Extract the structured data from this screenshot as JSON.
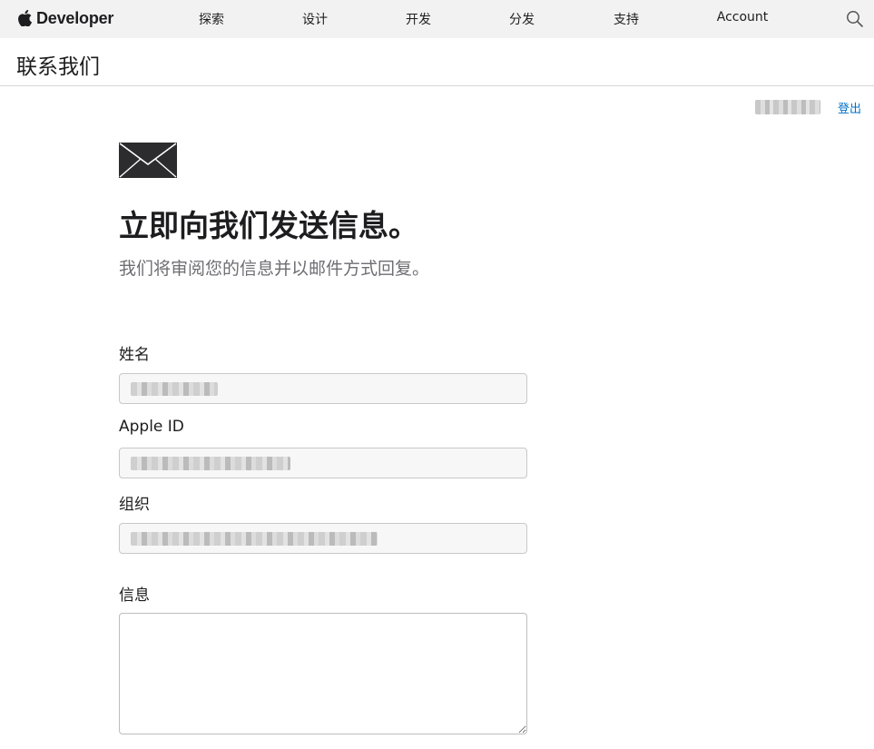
{
  "global_nav": {
    "brand": "Developer",
    "items": [
      "探索",
      "设计",
      "开发",
      "分发",
      "支持",
      "Account"
    ],
    "icons": {
      "logo": "apple-logo-icon",
      "search": "search-icon"
    }
  },
  "local_nav": {
    "title": "联系我们"
  },
  "user": {
    "name": "████ ████",
    "logout_label": "登出"
  },
  "main": {
    "icon": "envelope-icon",
    "headline": "立即向我们发送信息。",
    "subhead": "我们将审阅您的信息并以邮件方式回复。"
  },
  "form": {
    "name": {
      "label": "姓名",
      "value": "█████ █████"
    },
    "apple_id": {
      "label": "Apple ID",
      "value": "███████████████@███.███"
    },
    "organization": {
      "label": "组织",
      "value": "███████ █████ ██████████ ███ ███"
    },
    "message": {
      "label": "信息",
      "value": ""
    }
  },
  "colors": {
    "nav_bg": "#f2f2f2",
    "link": "#0070c9",
    "text": "#1d1d1f",
    "muted": "#6e6e73"
  }
}
